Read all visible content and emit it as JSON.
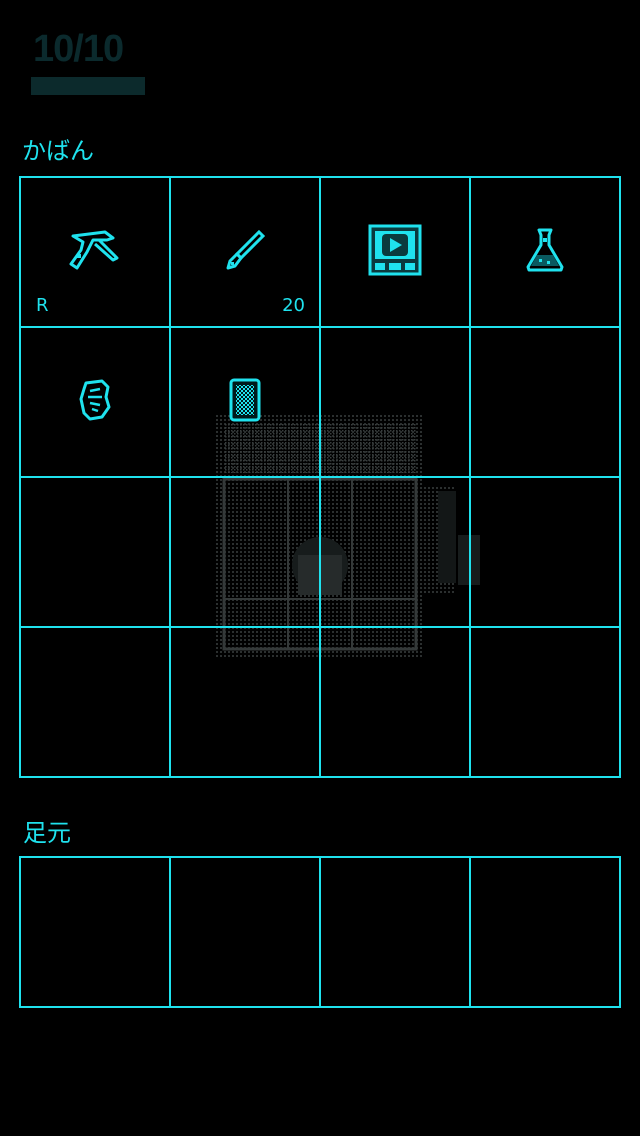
{
  "status": {
    "hp_text": "10/10",
    "hp_fraction": 1.0
  },
  "bag": {
    "title": "かばん",
    "slots": [
      {
        "icon": "pickaxe-icon",
        "rank": "R",
        "count": ""
      },
      {
        "icon": "brush-icon",
        "rank": "",
        "count": "20"
      },
      {
        "icon": "video-device-icon",
        "rank": "",
        "count": ""
      },
      {
        "icon": "flask-icon",
        "rank": "",
        "count": ""
      },
      {
        "icon": "ore-chunk-icon",
        "rank": "",
        "count": ""
      },
      {
        "icon": "card-icon",
        "rank": "",
        "count": ""
      },
      {
        "icon": "",
        "rank": "",
        "count": ""
      },
      {
        "icon": "",
        "rank": "",
        "count": ""
      },
      {
        "icon": "",
        "rank": "",
        "count": ""
      },
      {
        "icon": "",
        "rank": "",
        "count": ""
      },
      {
        "icon": "",
        "rank": "",
        "count": ""
      },
      {
        "icon": "",
        "rank": "",
        "count": ""
      },
      {
        "icon": "",
        "rank": "",
        "count": ""
      },
      {
        "icon": "",
        "rank": "",
        "count": ""
      },
      {
        "icon": "",
        "rank": "",
        "count": ""
      },
      {
        "icon": "",
        "rank": "",
        "count": ""
      }
    ]
  },
  "floor": {
    "title": "足元",
    "slots": [
      {
        "icon": ""
      },
      {
        "icon": ""
      },
      {
        "icon": ""
      },
      {
        "icon": ""
      }
    ]
  },
  "colors": {
    "accent": "#1fe2ee",
    "background": "#000000",
    "dim": "#0c2a2c"
  }
}
